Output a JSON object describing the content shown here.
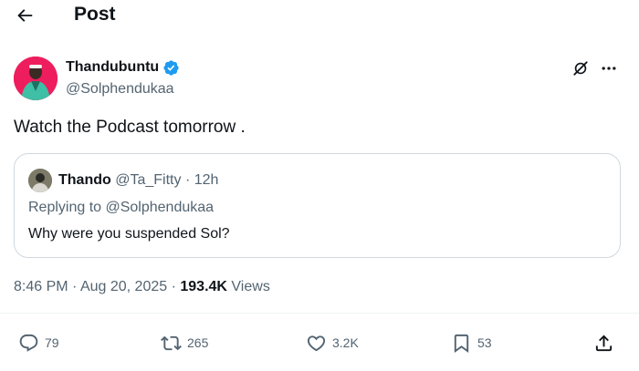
{
  "header": {
    "title": "Post",
    "back_icon": "arrow-left-icon"
  },
  "post": {
    "author": {
      "display_name": "Thandubuntu",
      "handle": "@Solphendukaa",
      "verified": true,
      "avatar_bg": "#ee1d5d"
    },
    "text": "Watch the Podcast tomorrow .",
    "quote": {
      "display_name": "Thando",
      "handle": "@Ta_Fitty",
      "separator": "·",
      "time": "12h",
      "replying_to": "Replying to @Solphendukaa",
      "text": "Why were you suspended Sol?"
    },
    "meta": {
      "time": "8:46 PM",
      "separator": "·",
      "date": "Aug 20, 2025",
      "views_count": "193.4K",
      "views_label": "Views"
    },
    "actions": {
      "replies": "79",
      "reposts": "265",
      "likes": "3.2K",
      "bookmarks": "53"
    }
  },
  "colors": {
    "text_primary": "#0f1419",
    "text_secondary": "#536471",
    "border": "#cfd9de",
    "verified_blue": "#1d9bf0"
  }
}
